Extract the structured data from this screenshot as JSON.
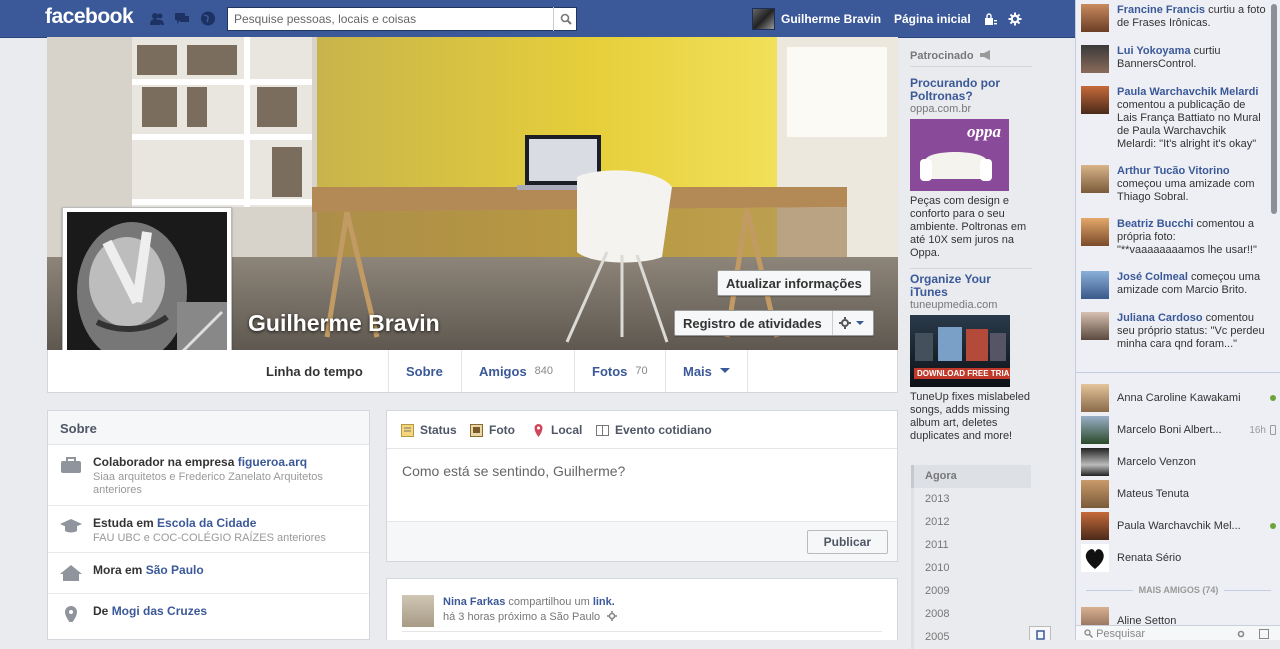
{
  "topbar": {
    "logo": "facebook",
    "search_placeholder": "Pesquise pessoas, locais e coisas",
    "user_name": "Guilherme Bravin",
    "home_label": "Página inicial"
  },
  "profile": {
    "name": "Guilherme Bravin",
    "update_info_button": "Atualizar informações",
    "activity_log_button": "Registro de atividades",
    "tabs": [
      {
        "label": "Linha do tempo",
        "count": ""
      },
      {
        "label": "Sobre",
        "count": ""
      },
      {
        "label": "Amigos",
        "count": "840"
      },
      {
        "label": "Fotos",
        "count": "70"
      },
      {
        "label": "Mais",
        "count": ""
      }
    ]
  },
  "about": {
    "title": "Sobre",
    "rows": [
      {
        "icon": "briefcase-icon",
        "prefix": "Colaborador na empresa ",
        "link": "figueroa.arq",
        "suffix": "",
        "sub": "Siaa arquitetos e Frederico Zanelato Arquitetos anteriores"
      },
      {
        "icon": "graduation-cap-icon",
        "prefix": "Estuda em ",
        "link": "Escola da Cidade",
        "suffix": "",
        "sub": "FAU UBC e COC-COLÉGIO RAÍZES anteriores"
      },
      {
        "icon": "home-icon",
        "prefix": "Mora em ",
        "link": "São Paulo",
        "suffix": "",
        "sub": ""
      },
      {
        "icon": "pin-icon",
        "prefix": "De ",
        "link": "Mogi das Cruzes",
        "suffix": "",
        "sub": ""
      }
    ]
  },
  "composer": {
    "tabs": [
      "Status",
      "Foto",
      "Local",
      "Evento cotidiano"
    ],
    "placeholder": "Como está se sentindo, Guilherme?",
    "publish": "Publicar"
  },
  "story": {
    "author": "Nina Farkas",
    "action": " compartilhou um ",
    "object": "link.",
    "meta": "há 3 horas próximo a São Paulo"
  },
  "ads": {
    "header": "Patrocinado",
    "items": [
      {
        "title": "Procurando por Poltronas?",
        "domain": "oppa.com.br",
        "image_text": "oppa",
        "text": "Peças com design e conforto para o seu ambiente. Poltronas em até 10X sem juros na Oppa."
      },
      {
        "title": "Organize Your iTunes",
        "domain": "tuneupmedia.com",
        "image_text": "DOWNLOAD FREE TRIAL",
        "text": "TuneUp fixes mislabeled songs, adds missing album art, deletes duplicates and more!"
      }
    ]
  },
  "years": [
    "Agora",
    "2013",
    "2012",
    "2011",
    "2010",
    "2009",
    "2008",
    "2005"
  ],
  "ticker": [
    {
      "name": "Francine Francis",
      "text": " curtiu a foto de Frases Irônicas."
    },
    {
      "name": "Lui Yokoyama",
      "text": " curtiu BannersControl."
    },
    {
      "name": "Paula Warchavchik Melardi",
      "text": " comentou a publicação de Lais França Battiato no Mural de Paula Warchavchik Melardi: \"It's alright it's okay\""
    },
    {
      "name": "Arthur Tucão Vitorino",
      "text": " começou uma amizade com Thiago Sobral."
    },
    {
      "name": "Beatriz Bucchi",
      "text": " comentou a própria foto: \"**vaaaaaaaamos lhe usar!!\""
    },
    {
      "name": "José Colmeal",
      "text": " começou uma amizade com Marcio Brito."
    },
    {
      "name": "Juliana Cardoso",
      "text": " comentou seu próprio status: \"Vc perdeu minha cara qnd foram...\""
    }
  ],
  "chat": {
    "friends": [
      {
        "name": "Anna Caroline Kawakami",
        "status": "online",
        "time": ""
      },
      {
        "name": "Marcelo Boni Albert...",
        "status": "mobile",
        "time": "16h"
      },
      {
        "name": "Marcelo Venzon",
        "status": "",
        "time": ""
      },
      {
        "name": "Mateus Tenuta",
        "status": "",
        "time": ""
      },
      {
        "name": "Paula Warchavchik Mel...",
        "status": "online",
        "time": ""
      },
      {
        "name": "Renata Sério",
        "status": "",
        "time": ""
      }
    ],
    "more_friends_label": "MAIS AMIGOS (74)",
    "more_friends": [
      {
        "name": "Aline Setton"
      }
    ],
    "search_placeholder": "Pesquisar"
  },
  "colors": {
    "brand": "#3b5998",
    "online": "#6ba539"
  }
}
